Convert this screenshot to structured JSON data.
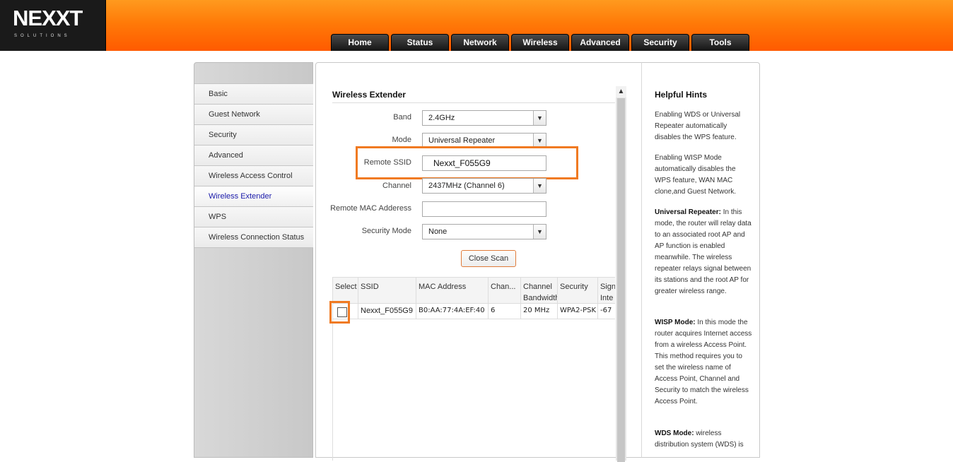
{
  "brand": {
    "logo": "NEXXT",
    "sub": "SOLUTIONS"
  },
  "tabs": [
    "Home",
    "Status",
    "Network",
    "Wireless",
    "Advanced",
    "Security",
    "Tools"
  ],
  "sidebar": {
    "items": [
      {
        "label": "Basic"
      },
      {
        "label": "Guest Network"
      },
      {
        "label": "Security"
      },
      {
        "label": "Advanced"
      },
      {
        "label": "Wireless Access Control"
      },
      {
        "label": "Wireless Extender"
      },
      {
        "label": "WPS"
      },
      {
        "label": "Wireless Connection Status"
      }
    ],
    "active": "Wireless Extender"
  },
  "main": {
    "title": "Wireless Extender",
    "form": {
      "band_label": "Band",
      "band_value": "2.4GHz",
      "mode_label": "Mode",
      "mode_value": "Universal Repeater",
      "ssid_label": "Remote SSID",
      "ssid_value": "Nexxt_F055G9",
      "channel_label": "Channel",
      "channel_value": "2437MHz (Channel 6)",
      "mac_label": "Remote MAC Adderess",
      "mac_value": "",
      "secmode_label": "Security Mode",
      "secmode_value": "None"
    },
    "close_scan": "Close Scan",
    "table": {
      "headers": [
        "Select",
        "SSID",
        "MAC Address",
        "Chan...",
        "Channel Bandwidth",
        "Security",
        "Sign Inte"
      ],
      "rows": [
        {
          "ssid": "Nexxt_F055G9",
          "mac": "B0:AA:77:4A:EF:40",
          "channel": "6",
          "bandwidth": "20 MHz",
          "security": "WPA2-PSK",
          "signal": "-67"
        }
      ]
    }
  },
  "hints": {
    "title": "Helpful Hints",
    "p1": "Enabling WDS or Universal Repeater automatically disables the WPS feature.",
    "p2": "Enabling WISP Mode automatically disables the WPS feature, WAN MAC clone,and Guest Network.",
    "p3_title": "Universal Repeater:",
    "p3": " In this mode, the router will relay data to an associated root AP and AP function is enabled meanwhile. The wireless repeater relays signal between its stations and the root AP for greater wireless range.",
    "p4_title": "WISP Mode:",
    "p4": " In this mode the router acquires Internet access from a wireless Access Point. This method requires you to set the wireless name of Access Point, Channel and Security to match the wireless Access Point.",
    "p5_title": "WDS Mode:",
    "p5": " wireless distribution system (WDS) is"
  },
  "colors": {
    "accent": "#ff6a00",
    "highlight": "#f07a22",
    "active_link": "#1a1aaa"
  }
}
